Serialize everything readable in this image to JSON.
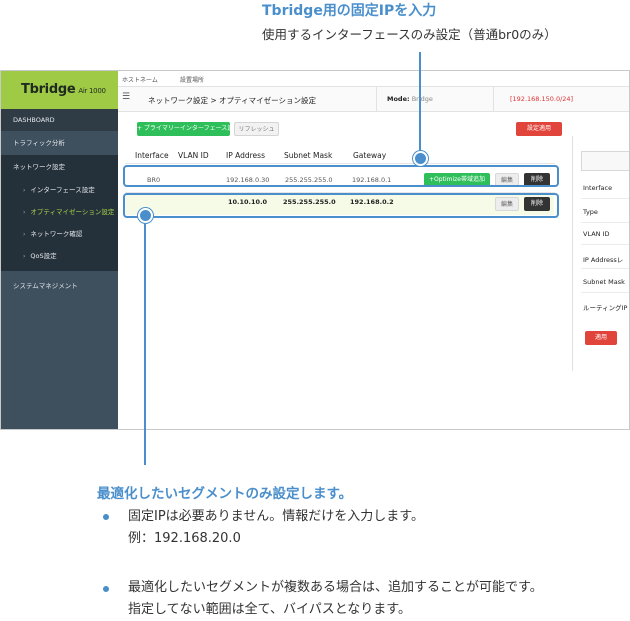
{
  "annotations": {
    "top_title": "Tbridge用の固定IPを入力",
    "top_sub": "使用するインターフェースのみ設定（普通br0のみ）",
    "bottom_title": "最適化したいセグメントのみ設定します。",
    "bullets": [
      {
        "line1": "固定IPは必要ありません。情報だけを入力します。",
        "line2": "例：192.168.20.0"
      },
      {
        "line1": "最適化したいセグメントが複数ある場合は、追加することが可能です。",
        "line2": "指定してない範囲は全て、バイパスとなります。"
      }
    ],
    "accent_color": "#4a8fcc"
  },
  "app": {
    "logo": "Tbridge",
    "logo_suffix": "Air 1000",
    "topbar_host": "ホストネーム",
    "topbar_place": "設置場所",
    "breadcrumb": "ネットワーク設定 > オプティマイゼーション設定",
    "mode_label": "Mode:",
    "mode_value": "Bridge",
    "ip_display": "[192.168.150.0/24]"
  },
  "sidebar": {
    "items": [
      {
        "label": "DASHBOARD"
      },
      {
        "label": "トラフィック分析"
      },
      {
        "label": "ネットワーク設定"
      },
      {
        "label": "インターフェース設定"
      },
      {
        "label": "オプティマイゼーション設定"
      },
      {
        "label": "ネットワーク確認"
      },
      {
        "label": "QoS設定"
      },
      {
        "label": "システムマネジメント"
      }
    ]
  },
  "toolbar": {
    "add_label": "+ プライマリーインターフェース追加",
    "refresh_label": "リフレッシュ",
    "apply_label": "設定適用"
  },
  "table": {
    "headers": [
      "Interface",
      "VLAN ID",
      "IP Address",
      "Subnet Mask",
      "Gateway"
    ],
    "row1": {
      "interface": "BR0",
      "ip": "192.168.0.30",
      "mask": "255.255.255.0",
      "gateway": "192.168.0.1",
      "optimize_label": "+Optimize帯域追加",
      "edit_label": "編集",
      "delete_label": "削除"
    },
    "row2": {
      "ip": "10.10.10.0",
      "mask": "255.255.255.0",
      "gateway": "192.168.0.2",
      "edit_label": "編集",
      "delete_label": "削除"
    }
  },
  "panel": {
    "fields": [
      "Interface",
      "Type",
      "VLAN ID",
      "IP Addressレ",
      "Subnet Mask",
      "ルーティングIP"
    ],
    "apply_label": "適用"
  }
}
